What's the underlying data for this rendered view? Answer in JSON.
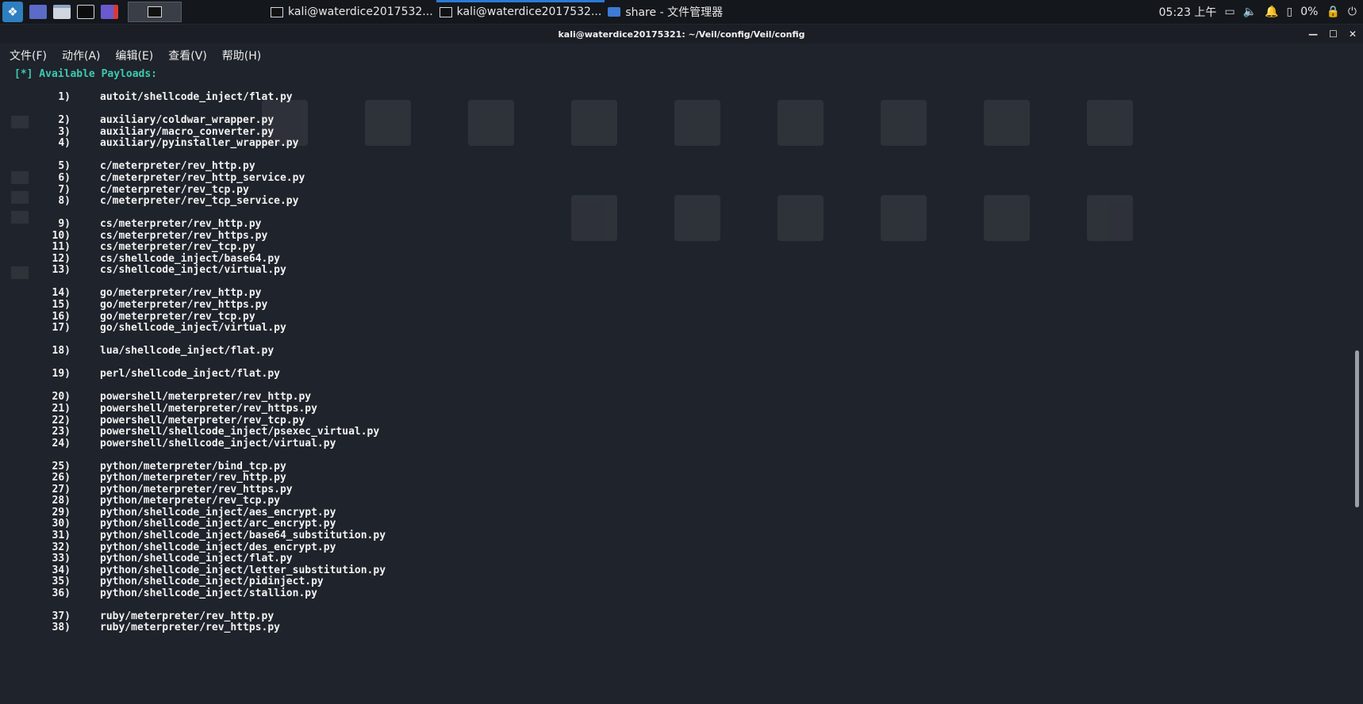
{
  "panel": {
    "tasks": [
      {
        "label": "kali@waterdice2017532...",
        "icon": "terminal-icon",
        "active": false
      },
      {
        "label": "kali@waterdice2017532...",
        "icon": "terminal-icon",
        "active": true
      },
      {
        "label": "share - 文件管理器",
        "icon": "folder-icon",
        "active": false
      }
    ],
    "clock": "05:23 上午",
    "battery": "0%"
  },
  "window": {
    "title": "kali@waterdice20175321: ~/Veil/config/Veil/config"
  },
  "menu": [
    "文件(F)",
    "动作(A)",
    "编辑(E)",
    "查看(V)",
    "帮助(H)"
  ],
  "terminal": {
    "header": "[*] Available Payloads:",
    "payloads": [
      {
        "num": "1)",
        "path": "autoit/shellcode_inject/flat.py"
      },
      {
        "num": "2)",
        "path": "auxiliary/coldwar_wrapper.py"
      },
      {
        "num": "3)",
        "path": "auxiliary/macro_converter.py"
      },
      {
        "num": "4)",
        "path": "auxiliary/pyinstaller_wrapper.py"
      },
      {
        "num": "5)",
        "path": "c/meterpreter/rev_http.py"
      },
      {
        "num": "6)",
        "path": "c/meterpreter/rev_http_service.py"
      },
      {
        "num": "7)",
        "path": "c/meterpreter/rev_tcp.py"
      },
      {
        "num": "8)",
        "path": "c/meterpreter/rev_tcp_service.py"
      },
      {
        "num": "9)",
        "path": "cs/meterpreter/rev_http.py"
      },
      {
        "num": "10)",
        "path": "cs/meterpreter/rev_https.py"
      },
      {
        "num": "11)",
        "path": "cs/meterpreter/rev_tcp.py"
      },
      {
        "num": "12)",
        "path": "cs/shellcode_inject/base64.py"
      },
      {
        "num": "13)",
        "path": "cs/shellcode_inject/virtual.py"
      },
      {
        "num": "14)",
        "path": "go/meterpreter/rev_http.py"
      },
      {
        "num": "15)",
        "path": "go/meterpreter/rev_https.py"
      },
      {
        "num": "16)",
        "path": "go/meterpreter/rev_tcp.py"
      },
      {
        "num": "17)",
        "path": "go/shellcode_inject/virtual.py"
      },
      {
        "num": "18)",
        "path": "lua/shellcode_inject/flat.py"
      },
      {
        "num": "19)",
        "path": "perl/shellcode_inject/flat.py"
      },
      {
        "num": "20)",
        "path": "powershell/meterpreter/rev_http.py"
      },
      {
        "num": "21)",
        "path": "powershell/meterpreter/rev_https.py"
      },
      {
        "num": "22)",
        "path": "powershell/meterpreter/rev_tcp.py"
      },
      {
        "num": "23)",
        "path": "powershell/shellcode_inject/psexec_virtual.py"
      },
      {
        "num": "24)",
        "path": "powershell/shellcode_inject/virtual.py"
      },
      {
        "num": "25)",
        "path": "python/meterpreter/bind_tcp.py"
      },
      {
        "num": "26)",
        "path": "python/meterpreter/rev_http.py"
      },
      {
        "num": "27)",
        "path": "python/meterpreter/rev_https.py"
      },
      {
        "num": "28)",
        "path": "python/meterpreter/rev_tcp.py"
      },
      {
        "num": "29)",
        "path": "python/shellcode_inject/aes_encrypt.py"
      },
      {
        "num": "30)",
        "path": "python/shellcode_inject/arc_encrypt.py"
      },
      {
        "num": "31)",
        "path": "python/shellcode_inject/base64_substitution.py"
      },
      {
        "num": "32)",
        "path": "python/shellcode_inject/des_encrypt.py"
      },
      {
        "num": "33)",
        "path": "python/shellcode_inject/flat.py"
      },
      {
        "num": "34)",
        "path": "python/shellcode_inject/letter_substitution.py"
      },
      {
        "num": "35)",
        "path": "python/shellcode_inject/pidinject.py"
      },
      {
        "num": "36)",
        "path": "python/shellcode_inject/stallion.py"
      },
      {
        "num": "37)",
        "path": "ruby/meterpreter/rev_http.py"
      },
      {
        "num": "38)",
        "path": "ruby/meterpreter/rev_https.py"
      }
    ]
  },
  "colors": {
    "terminal_bg": "#1f232b",
    "header_accent": "#3ec9b0",
    "panel_bg": "#14171c",
    "active_task": "#2b7bd6"
  }
}
